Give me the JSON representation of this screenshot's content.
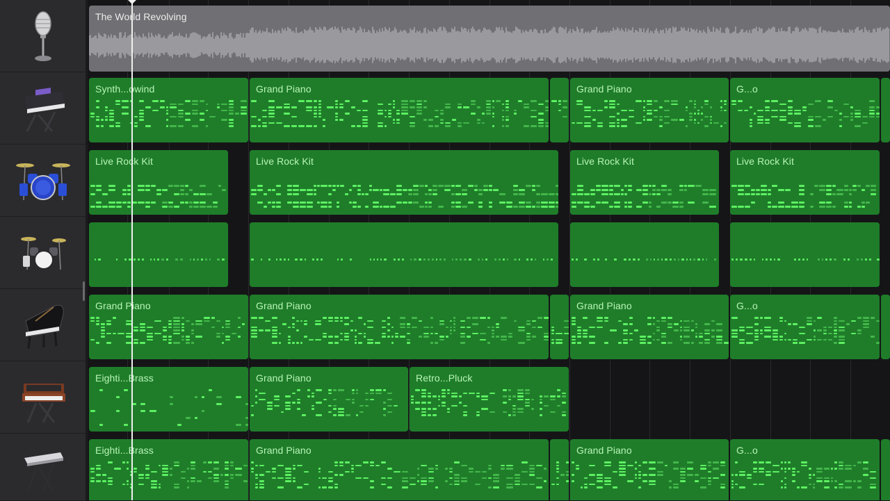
{
  "tracks": [
    {
      "instrument_icon": "microphone-icon",
      "type": "audio",
      "regions": [
        {
          "label": "The World Revolving"
        }
      ]
    },
    {
      "instrument_icon": "synth-keyboard-icon",
      "type": "midi",
      "regions": [
        {
          "label": "Synth...owind"
        },
        {
          "label": "Grand Piano"
        },
        {
          "label": ""
        },
        {
          "label": "Grand Piano"
        },
        {
          "label": "G...o"
        },
        {
          "label": ""
        }
      ]
    },
    {
      "instrument_icon": "drum-kit-icon",
      "type": "midi",
      "regions": [
        {
          "label": "Live Rock Kit"
        },
        {
          "label": "Live Rock Kit"
        },
        {
          "label": "Live Rock Kit"
        },
        {
          "label": "Live Rock Kit"
        }
      ]
    },
    {
      "instrument_icon": "drum-kit-small-icon",
      "type": "midi",
      "regions": [
        {
          "label": ""
        },
        {
          "label": ""
        },
        {
          "label": ""
        },
        {
          "label": ""
        }
      ]
    },
    {
      "instrument_icon": "grand-piano-icon",
      "type": "midi",
      "regions": [
        {
          "label": "Grand Piano"
        },
        {
          "label": "Grand Piano"
        },
        {
          "label": ""
        },
        {
          "label": "Grand Piano"
        },
        {
          "label": "G...o"
        },
        {
          "label": ""
        }
      ]
    },
    {
      "instrument_icon": "vintage-synth-icon",
      "type": "midi",
      "regions": [
        {
          "label": "Eighti...Brass"
        },
        {
          "label": "Grand Piano"
        },
        {
          "label": "Retro...Pluck"
        }
      ]
    },
    {
      "instrument_icon": "keyboard-stand-icon",
      "type": "midi",
      "regions": [
        {
          "label": "Eighti...Brass"
        },
        {
          "label": "Grand Piano"
        },
        {
          "label": ""
        },
        {
          "label": "Grand Piano"
        },
        {
          "label": "G...o"
        },
        {
          "label": ""
        }
      ]
    }
  ],
  "colors": {
    "midi_region": "#1f7d2a",
    "midi_note": "#5df062",
    "audio_region": "#707074",
    "waveform": "#9a9a9e",
    "background": "#151517",
    "header_bg": "#2b2b2e",
    "playhead": "#f0f0f0"
  }
}
